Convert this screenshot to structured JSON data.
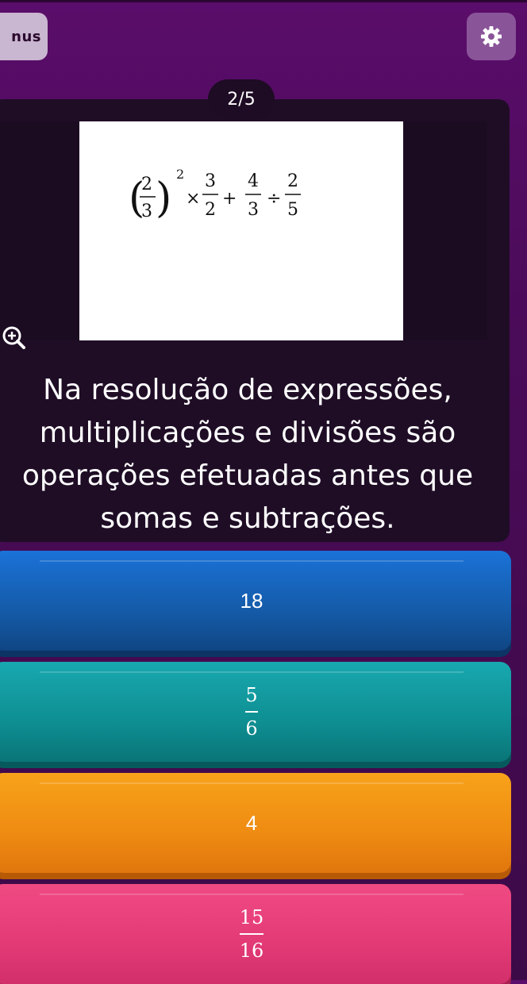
{
  "header": {
    "bonus_label": "nus",
    "settings_icon": "gear-icon",
    "question_counter": "2/5"
  },
  "question": {
    "expression": {
      "base_num": "2",
      "base_den": "3",
      "exponent": "2",
      "op1": "×",
      "f1_num": "3",
      "f1_den": "2",
      "op2": "+",
      "f2_num": "4",
      "f2_den": "3",
      "op3": "÷",
      "f3_num": "2",
      "f3_den": "5"
    },
    "zoom_icon": "zoom-in-icon",
    "text": "Na resolução de expressões, multiplicações e divisões são operações efetuadas antes que somas e subtrações."
  },
  "answers": [
    {
      "type": "text",
      "value": "18",
      "color": "#155ba8"
    },
    {
      "type": "fraction",
      "numerator": "5",
      "denominator": "6",
      "color": "#0e8f92"
    },
    {
      "type": "text",
      "value": "4",
      "color": "#ef8b12"
    },
    {
      "type": "fraction",
      "numerator": "15",
      "denominator": "16",
      "color": "#e33a76"
    }
  ]
}
